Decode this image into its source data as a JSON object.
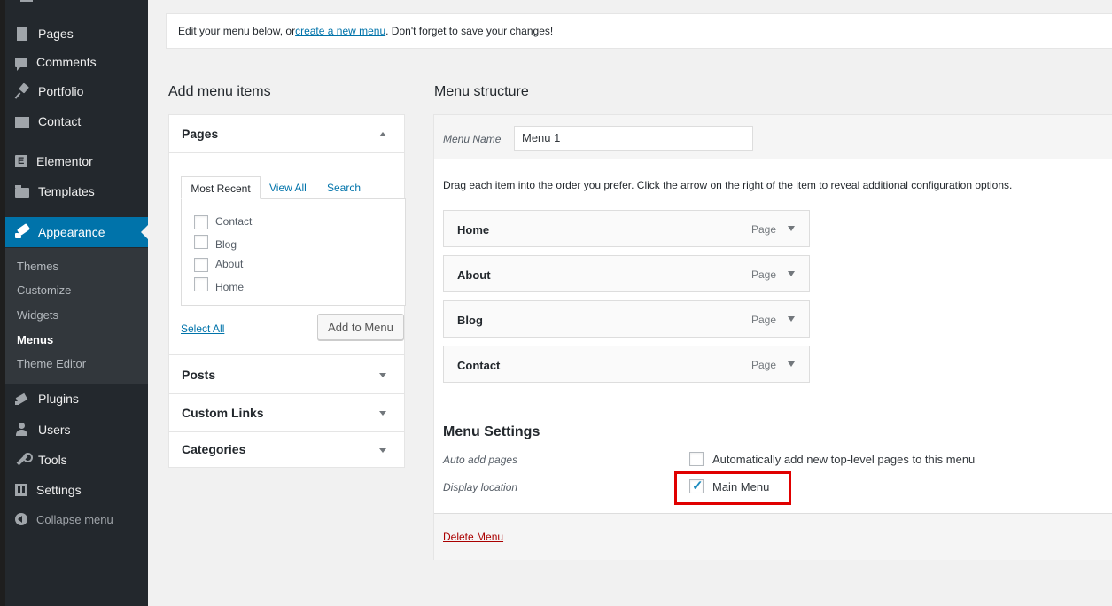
{
  "sidebar": {
    "items": [
      {
        "label": "Pages",
        "icon": "pages-icon"
      },
      {
        "label": "Comments",
        "icon": "comments-icon"
      },
      {
        "label": "Portfolio",
        "icon": "pin-icon"
      },
      {
        "label": "Contact",
        "icon": "mail-icon"
      },
      {
        "label": "Elementor",
        "icon": "elementor-icon"
      },
      {
        "label": "Templates",
        "icon": "folder-icon"
      },
      {
        "label": "Appearance",
        "icon": "brush-icon"
      },
      {
        "label": "Plugins",
        "icon": "plugin-icon"
      },
      {
        "label": "Users",
        "icon": "users-icon"
      },
      {
        "label": "Tools",
        "icon": "wrench-icon"
      },
      {
        "label": "Settings",
        "icon": "settings-icon"
      },
      {
        "label": "Collapse menu",
        "icon": "collapse-icon"
      }
    ],
    "appearance_submenu": [
      "Themes",
      "Customize",
      "Widgets",
      "Menus",
      "Theme Editor"
    ],
    "active_color": "#0073aa"
  },
  "notice": {
    "before": "Edit your menu below, or ",
    "link": "create a new menu",
    "after": ". Don't forget to save your changes!"
  },
  "add_items": {
    "title": "Add menu items",
    "sections": {
      "pages": "Pages",
      "posts": "Posts",
      "custom_links": "Custom Links",
      "categories": "Categories"
    },
    "tabs": [
      "Most Recent",
      "View All",
      "Search"
    ],
    "pages_list": [
      "Contact",
      "Blog",
      "About",
      "Home"
    ],
    "select_all": "Select All",
    "add_button": "Add to Menu"
  },
  "structure": {
    "title": "Menu structure",
    "menu_name_label": "Menu Name",
    "menu_name_value": "Menu 1",
    "drag_hint": "Drag each item into the order you prefer. Click the arrow on the right of the item to reveal additional configuration options.",
    "items": [
      {
        "title": "Home",
        "type": "Page"
      },
      {
        "title": "About",
        "type": "Page"
      },
      {
        "title": "Blog",
        "type": "Page"
      },
      {
        "title": "Contact",
        "type": "Page"
      }
    ],
    "settings": {
      "title": "Menu Settings",
      "auto_add_label": "Auto add pages",
      "auto_add_option": "Automatically add new top-level pages to this menu",
      "auto_add_checked": false,
      "display_location_label": "Display location",
      "location_option": "Main Menu",
      "location_checked": true,
      "highlight_color": "#e00000"
    },
    "delete_link": "Delete Menu"
  }
}
